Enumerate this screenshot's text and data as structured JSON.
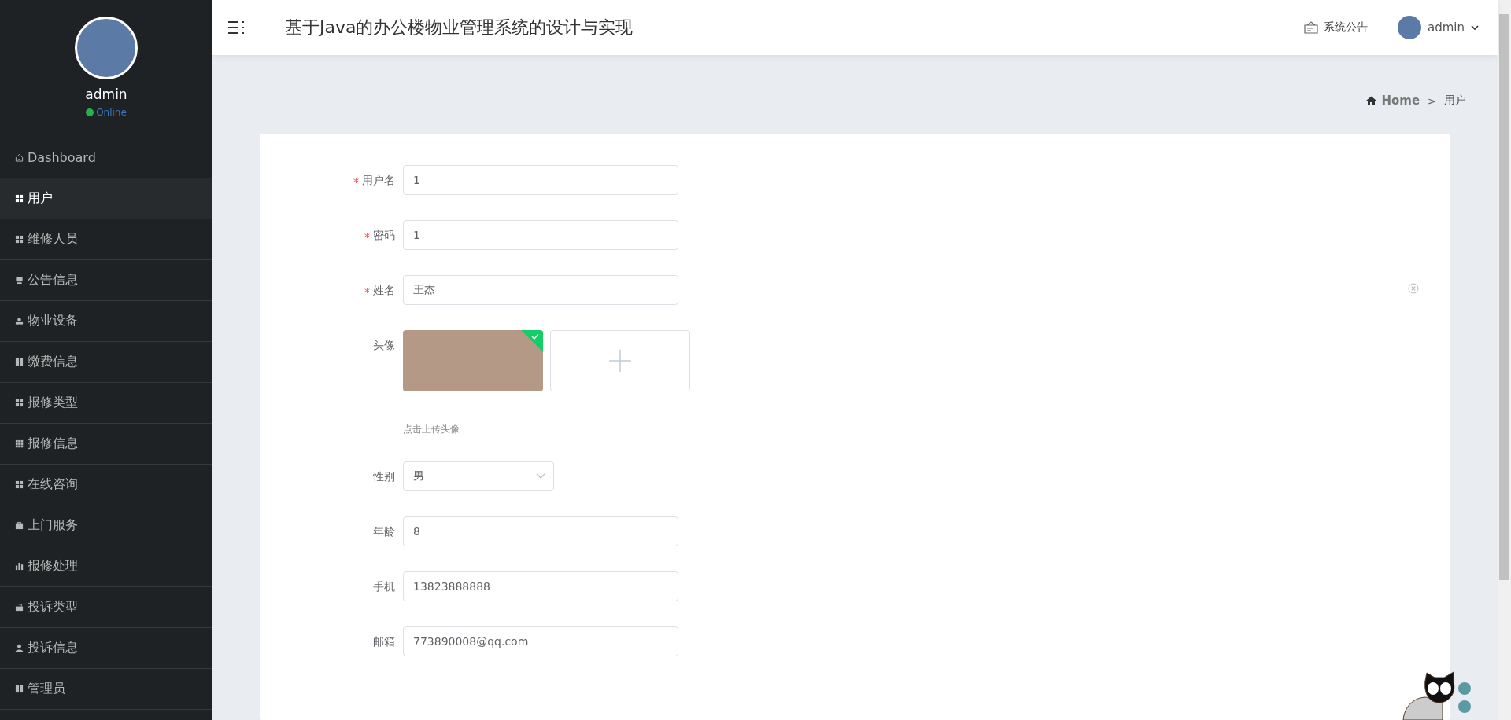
{
  "sidebar": {
    "user_name": "admin",
    "status": "Online",
    "items": [
      {
        "label": "Dashboard",
        "kind": "home",
        "selected": false
      },
      {
        "label": "用户",
        "kind": "grid",
        "selected": true
      },
      {
        "label": "维修人员",
        "kind": "grid",
        "selected": false
      },
      {
        "label": "公告信息",
        "kind": "chat",
        "selected": false
      },
      {
        "label": "物业设备",
        "kind": "stamp",
        "selected": false
      },
      {
        "label": "缴费信息",
        "kind": "grid",
        "selected": false
      },
      {
        "label": "报修类型",
        "kind": "grid",
        "selected": false
      },
      {
        "label": "报修信息",
        "kind": "apps",
        "selected": false
      },
      {
        "label": "在线咨询",
        "kind": "grid",
        "selected": false
      },
      {
        "label": "上门服务",
        "kind": "briefcase",
        "selected": false
      },
      {
        "label": "报修处理",
        "kind": "bars",
        "selected": false
      },
      {
        "label": "投诉类型",
        "kind": "mailbox",
        "selected": false
      },
      {
        "label": "投诉信息",
        "kind": "user",
        "selected": false
      },
      {
        "label": "管理员",
        "kind": "grid",
        "selected": false
      }
    ]
  },
  "header": {
    "title": "基于Java的办公楼物业管理系统的设计与实现",
    "notice": "系统公告",
    "user": "admin"
  },
  "breadcrumb": {
    "home": "Home",
    "separator": ">",
    "current": "用户"
  },
  "form": {
    "fields": [
      {
        "label": "用户名",
        "kind": "text",
        "required": true,
        "value": "1"
      },
      {
        "label": "密码",
        "kind": "text",
        "required": true,
        "value": "1"
      },
      {
        "label": "姓名",
        "kind": "text",
        "required": true,
        "value": "王杰"
      },
      {
        "label": "头像",
        "kind": "upload",
        "required": false,
        "hint": "点击上传头像"
      },
      {
        "label": "性别",
        "kind": "select",
        "required": false,
        "value": "男"
      },
      {
        "label": "年龄",
        "kind": "text",
        "required": false,
        "value": "8"
      },
      {
        "label": "手机",
        "kind": "text",
        "required": false,
        "value": "13823888888"
      },
      {
        "label": "邮箱",
        "kind": "text",
        "required": false,
        "value": "773890008@qq.com"
      }
    ]
  }
}
